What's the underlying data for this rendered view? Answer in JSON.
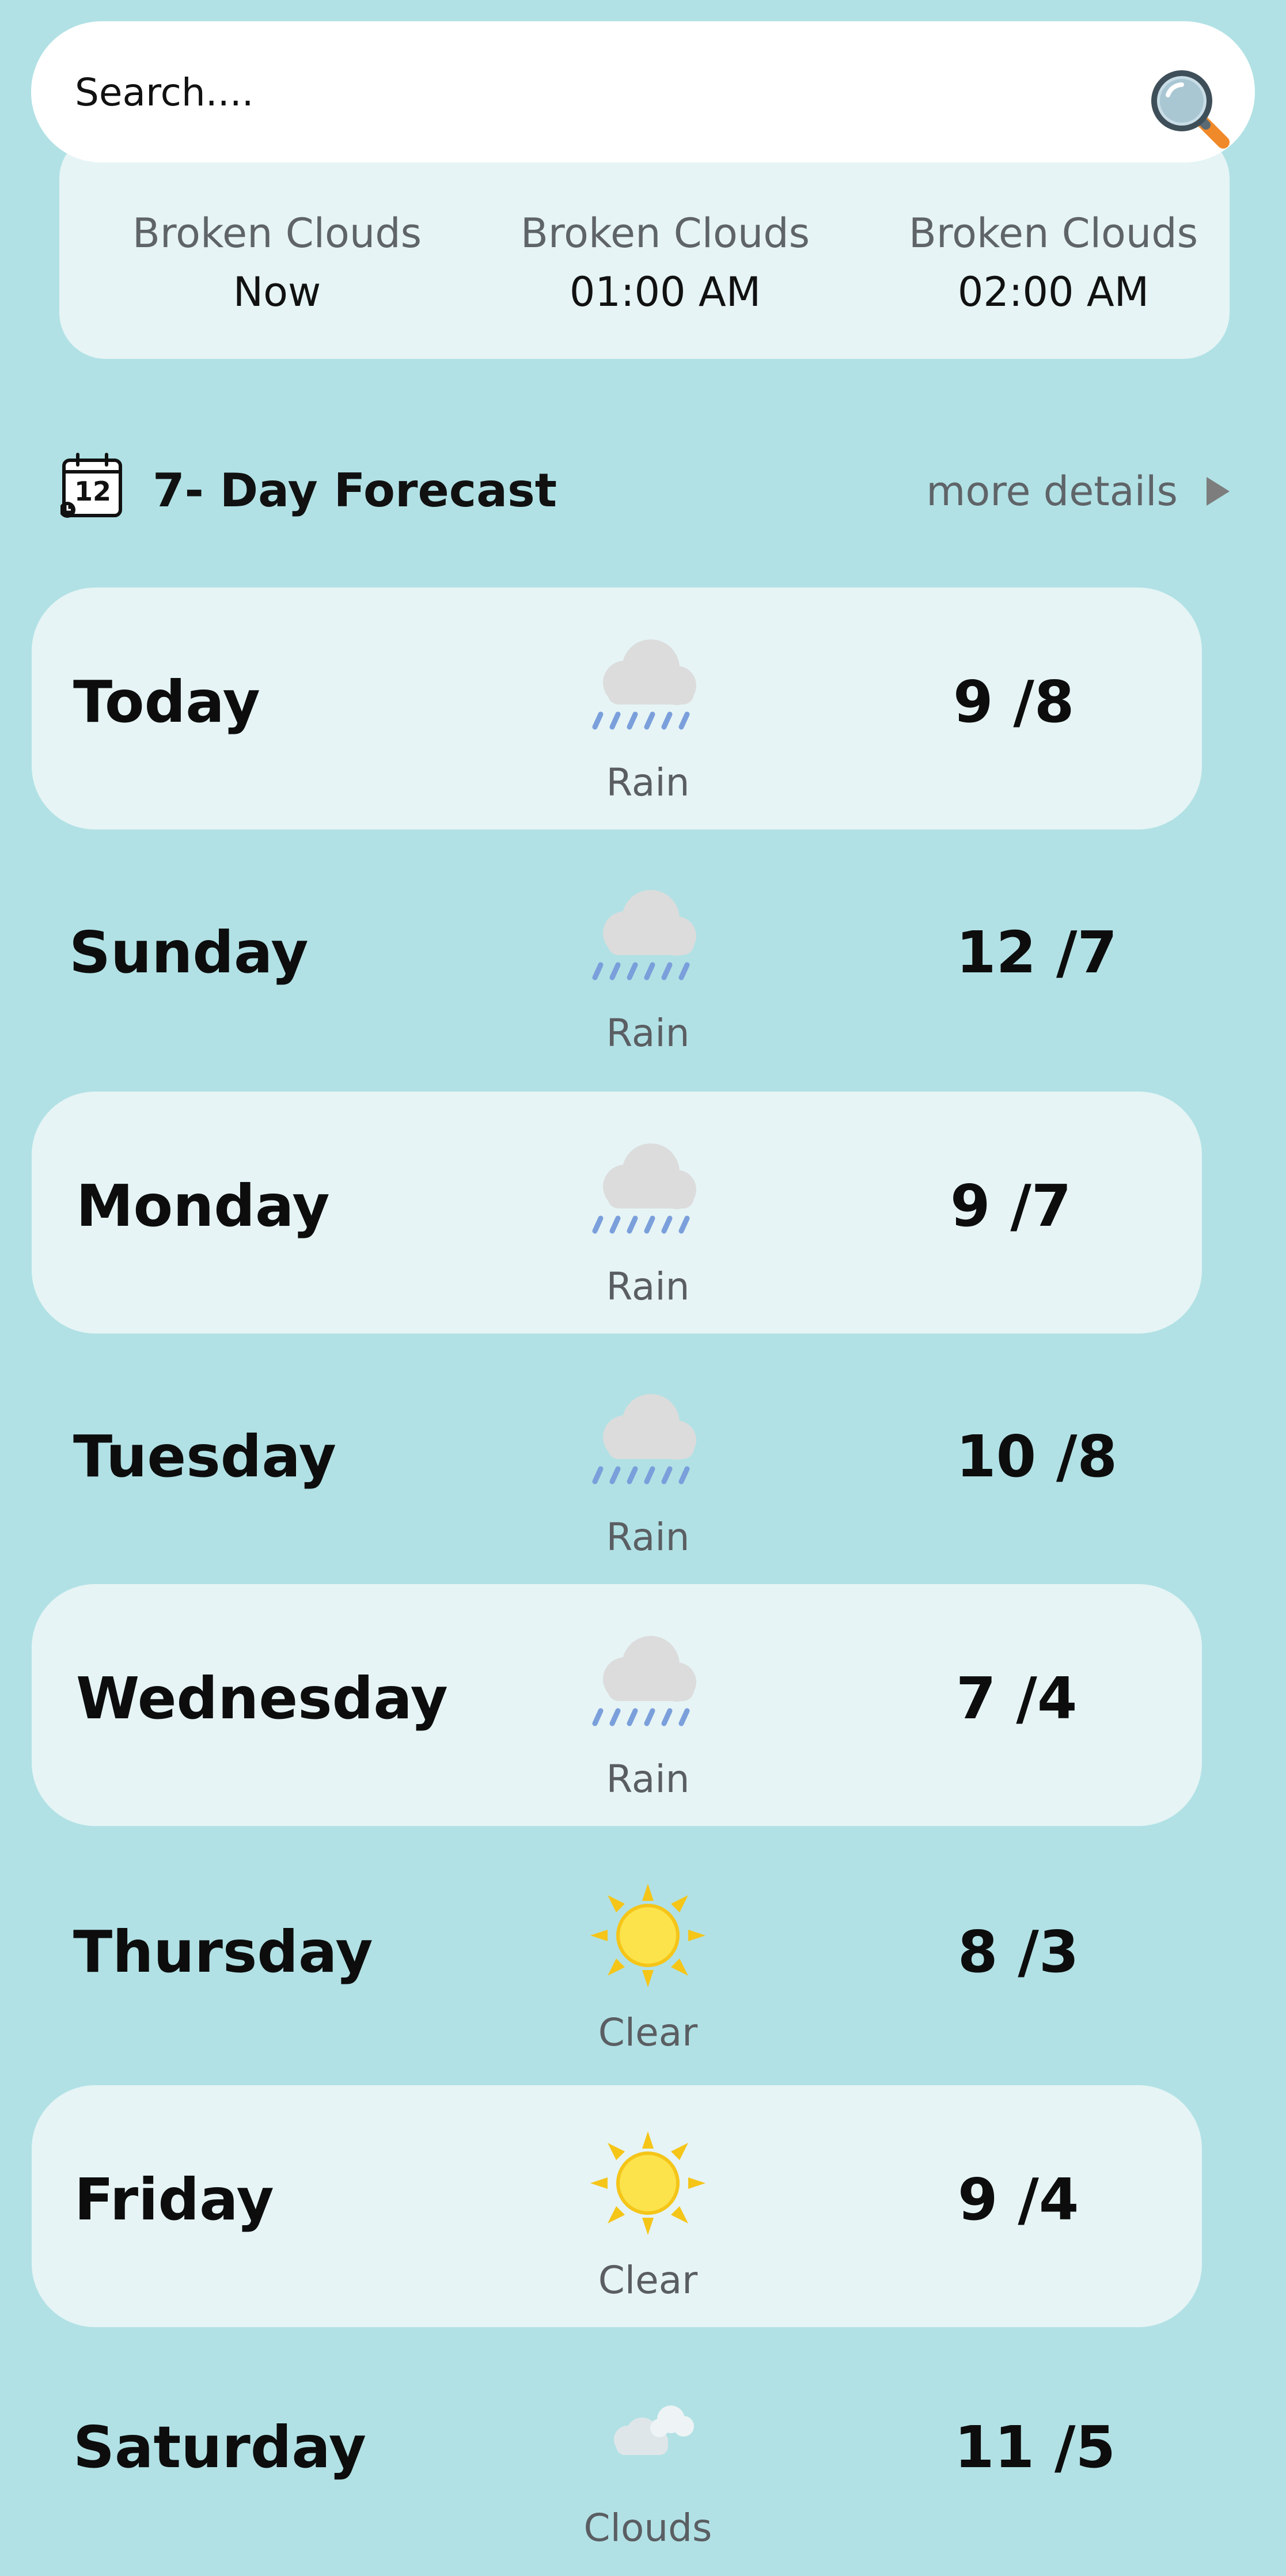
{
  "search": {
    "placeholder": "Search...."
  },
  "hourly": [
    {
      "condition": "Broken Clouds",
      "time": "Now"
    },
    {
      "condition": "Broken Clouds",
      "time": "01:00 AM"
    },
    {
      "condition": "Broken Clouds",
      "time": "02:00 AM"
    }
  ],
  "calendar_icon_text": "12",
  "forecast": {
    "title": "7- Day Forecast",
    "more_details": "more details",
    "days": [
      {
        "day": "Today",
        "icon": "rain-icon",
        "condition": "Rain",
        "temps": "9 /8"
      },
      {
        "day": "Sunday",
        "icon": "rain-icon",
        "condition": "Rain",
        "temps": "12 /7"
      },
      {
        "day": "Monday",
        "icon": "rain-icon",
        "condition": "Rain",
        "temps": "9 /7"
      },
      {
        "day": "Tuesday",
        "icon": "rain-icon",
        "condition": "Rain",
        "temps": "10 /8"
      },
      {
        "day": "Wednesday",
        "icon": "rain-icon",
        "condition": "Rain",
        "temps": "7 /4"
      },
      {
        "day": "Thursday",
        "icon": "sun-icon",
        "condition": "Clear",
        "temps": "8 /3"
      },
      {
        "day": "Friday",
        "icon": "sun-icon",
        "condition": "Clear",
        "temps": "9 /4"
      },
      {
        "day": "Saturday",
        "icon": "clouds-icon",
        "condition": "Clouds",
        "temps": "11 /5"
      }
    ]
  },
  "colors": {
    "background": "#b1e1e5",
    "card": "#e6f4f5",
    "rain_drops": "#7a9fdb",
    "sun": "#fce34c",
    "sun_rays": "#f5c518",
    "magnifier_handle": "#f0892a"
  }
}
